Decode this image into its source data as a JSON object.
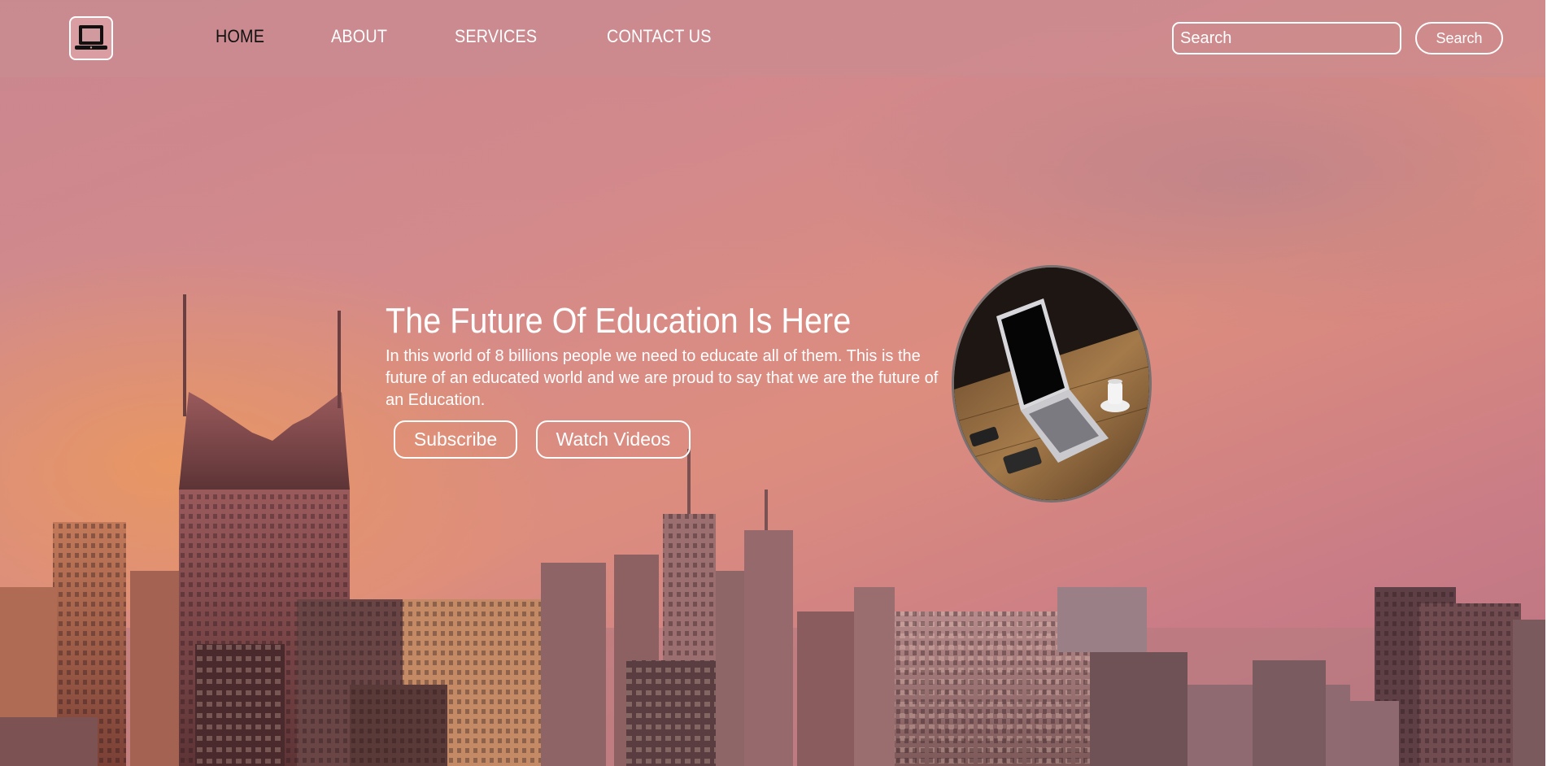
{
  "navbar": {
    "logo_icon": "laptop-icon",
    "links": [
      {
        "label": "HOME",
        "active": true
      },
      {
        "label": "ABOUT",
        "active": false
      },
      {
        "label": "SERVICES",
        "active": false
      },
      {
        "label": "CONTACT US",
        "active": false
      }
    ],
    "search": {
      "placeholder": "Search",
      "button_label": "Search"
    }
  },
  "hero": {
    "title": "The Future Of Education Is Here",
    "description": "In this world of 8 billions people we need to educate all of them. This is the future of an educated world and we are proud to say that we are the future of an Education.",
    "buttons": {
      "subscribe": "Subscribe",
      "watch": "Watch Videos"
    },
    "image_icon": "laptop-on-desk-photo"
  },
  "colors": {
    "overlay": "#d38a8c",
    "text": "#ffffff",
    "active_link": "#111111"
  }
}
